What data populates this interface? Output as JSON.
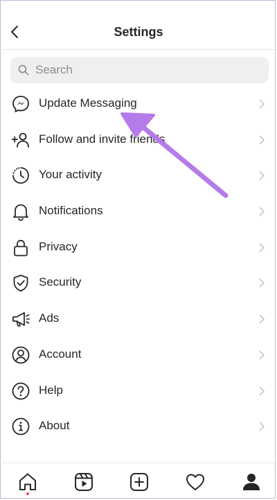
{
  "header": {
    "title": "Settings"
  },
  "search": {
    "placeholder": "Search"
  },
  "menu": {
    "items": [
      {
        "label": "Update Messaging",
        "icon": "messenger-icon"
      },
      {
        "label": "Follow and invite friends",
        "icon": "add-person-icon"
      },
      {
        "label": "Your activity",
        "icon": "activity-clock-icon"
      },
      {
        "label": "Notifications",
        "icon": "bell-icon"
      },
      {
        "label": "Privacy",
        "icon": "lock-icon"
      },
      {
        "label": "Security",
        "icon": "shield-check-icon"
      },
      {
        "label": "Ads",
        "icon": "megaphone-icon"
      },
      {
        "label": "Account",
        "icon": "account-icon"
      },
      {
        "label": "Help",
        "icon": "help-icon"
      },
      {
        "label": "About",
        "icon": "info-icon"
      }
    ]
  },
  "tabbar": {
    "tabs": [
      "home-icon",
      "reels-icon",
      "new-post-icon",
      "activity-heart-icon",
      "profile-icon"
    ],
    "active": "home-icon"
  },
  "colors": {
    "annotation_arrow": "#b57be8",
    "notification_dot": "#ed4956"
  }
}
